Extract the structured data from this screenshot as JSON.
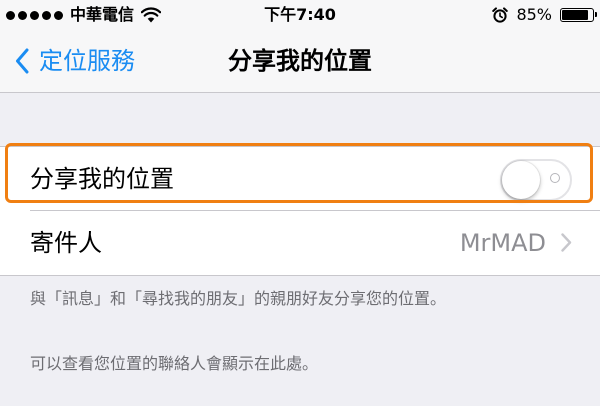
{
  "status_bar": {
    "signal_bars": 5,
    "carrier": "中華電信",
    "wifi_icon": "wifi-icon",
    "time": "下午7:40",
    "alarm_icon": "alarm-clock-icon",
    "battery_percent": "85%",
    "battery_level": 0.85
  },
  "nav": {
    "back_label": "定位服務",
    "back_icon": "chevron-left-icon",
    "title": "分享我的位置"
  },
  "settings": {
    "share_label": "分享我的位置",
    "share_enabled": false,
    "sender_label": "寄件人",
    "sender_value": "MrMAD",
    "disclosure_icon": "chevron-right-icon"
  },
  "footer": {
    "note": "與「訊息」和「尋找我的朋友」的親朋好友分享您的位置。",
    "contacts_note": "可以查看您位置的聯絡人會顯示在此處。"
  },
  "colors": {
    "tint": "#1a8cf2",
    "highlight": "#f07f12",
    "background": "#efeff4",
    "secondary_text": "#6d6d72"
  }
}
